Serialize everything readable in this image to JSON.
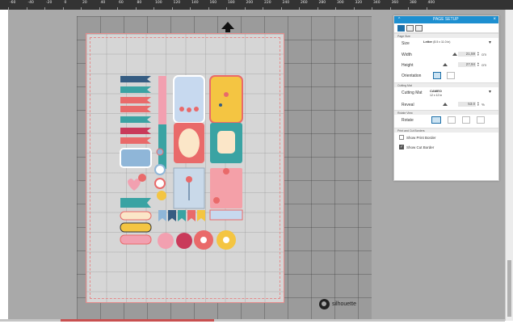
{
  "ruler": {
    "labels": [
      "-60",
      "-40",
      "-20",
      "0",
      "20",
      "40",
      "60",
      "80",
      "100",
      "120",
      "140",
      "160",
      "180",
      "200",
      "220",
      "240",
      "260",
      "280",
      "300",
      "320",
      "340",
      "360",
      "380",
      "400"
    ]
  },
  "panel": {
    "title": "PAGE SETUP",
    "close": "×",
    "collapse": "^",
    "sections": {
      "page_size": "Page Size",
      "cutting_mat": "Cutting Mat",
      "rotate_view": "Rotate View",
      "print_cut": "Print and Cut Borders"
    },
    "size": {
      "label": "Size",
      "value": "Letter",
      "detail": "(8.5 x 11.0 in)"
    },
    "width": {
      "label": "Width",
      "value": "21,59",
      "unit": "cm"
    },
    "height": {
      "label": "Height",
      "value": "27,94",
      "unit": "cm"
    },
    "orientation": {
      "label": "Orientation"
    },
    "cutting_mat": {
      "label": "Cutting Mat",
      "value": "CAMEO",
      "detail": "12 x 12 in"
    },
    "reveal": {
      "label": "Reveal",
      "value": "53.0",
      "unit": "%"
    },
    "rotate": {
      "label": "Rotate"
    },
    "show_print_border": {
      "label": "Show Print Border",
      "checked": false
    },
    "show_cut_border": {
      "label": "Show Cut Border",
      "checked": true
    }
  },
  "brand": {
    "name": "silhouette"
  },
  "colors": {
    "panel_header": "#1d8fd0",
    "mat": "#9b9b9b",
    "page": "#d6d6d6",
    "cut_border": "#e58a8a",
    "coral": "#e96a6a",
    "teal": "#3aa3a3",
    "blue": "#8fb6d8",
    "yellow": "#f4c542",
    "pink": "#f2a0b0",
    "navy": "#355c82"
  }
}
